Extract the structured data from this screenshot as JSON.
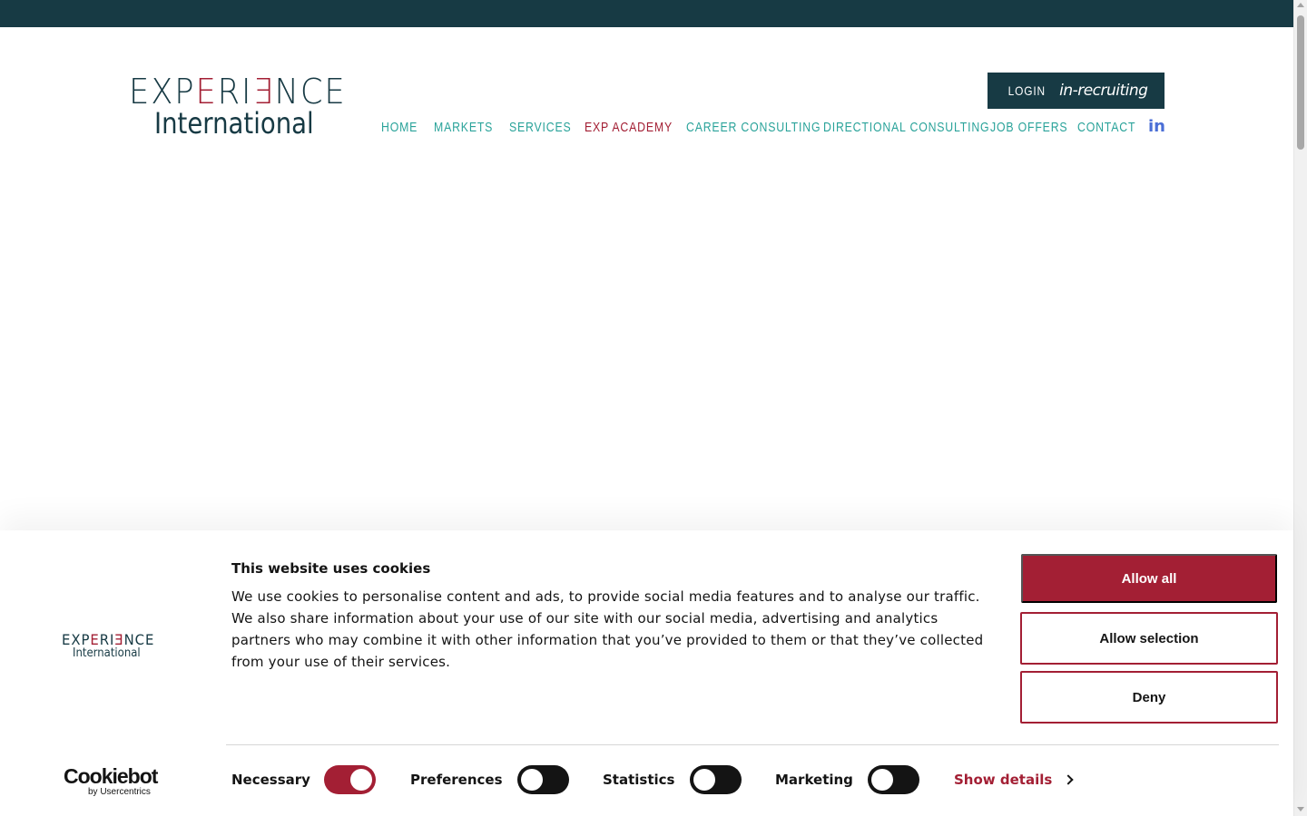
{
  "colors": {
    "brand_dark": "#173a44",
    "brand_red": "#a31f34",
    "nav_teal": "#2aa39a",
    "linkedin_blue": "#4a6ed6"
  },
  "header": {
    "logo": {
      "line1_a": "EXP",
      "line1_red_e": "E",
      "line1_b": "RI",
      "line1_red_reversed_e": "Ǝ",
      "line1_c": "NCE",
      "line2": "International"
    },
    "login_label": "LOGIN",
    "login_brand": "in-recruiting",
    "nav": [
      {
        "label": "HOME",
        "active": false
      },
      {
        "label": "MARKETS",
        "active": false
      },
      {
        "label": "SERVICES",
        "active": false
      },
      {
        "label": "EXP ACADEMY",
        "active": true
      },
      {
        "label": "CAREER CONSULTING",
        "active": false
      },
      {
        "label": "DIRECTIONAL CONSULTING",
        "active": false
      },
      {
        "label": "JOB OFFERS",
        "active": false
      },
      {
        "label": "CONTACT",
        "active": false
      }
    ],
    "linkedin_icon": "in"
  },
  "cookie_banner": {
    "title": "This website uses cookies",
    "text": "We use cookies to personalise content and ads, to provide social media features and to analyse our traffic. We also share information about your use of our site with our social media, advertising and analytics partners who may combine it with other information that you’ve provided to them or that they’ve collected from your use of their services.",
    "buttons": {
      "allow_all": "Allow all",
      "allow_selection": "Allow selection",
      "deny": "Deny"
    },
    "consents": [
      {
        "label": "Necessary",
        "enabled": true
      },
      {
        "label": "Preferences",
        "enabled": false
      },
      {
        "label": "Statistics",
        "enabled": false
      },
      {
        "label": "Marketing",
        "enabled": false
      }
    ],
    "show_details": "Show details",
    "cookiebot_name": "Cookiebot",
    "cookiebot_by": "by Usercentrics"
  }
}
